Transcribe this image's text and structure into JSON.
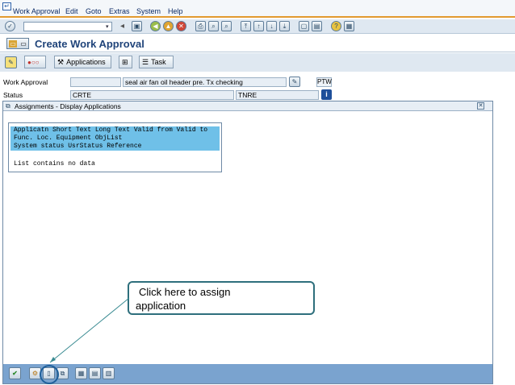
{
  "menu": {
    "items": [
      "Work Approval",
      "Edit",
      "Goto",
      "Extras",
      "System",
      "Help"
    ]
  },
  "screen": {
    "title": "Create Work Approval"
  },
  "app_toolbar": {
    "applications_label": "Applications",
    "task_label": "Task"
  },
  "form": {
    "work_approval_label": "Work Approval",
    "work_approval_value": "",
    "work_approval_desc": "seal air fan oil header pre. Tx checking",
    "ptw_label": "PTW",
    "status_label": "Status",
    "status_value": "CRTE",
    "status_user": "TNRE"
  },
  "dialog": {
    "title": "Assignments - Display Applications",
    "header_rows": [
      "Applicatn Short Text Long Text Valid from Valid to",
      "Func. Loc. Equipment ObjList",
      "System status UsrStatus Reference"
    ],
    "empty_message": "List contains no data"
  },
  "callout": {
    "text_line1": "Click here to assign",
    "text_line2": "application"
  },
  "colors": {
    "accent_blue": "#20447a",
    "highlight": "#6fc0e8",
    "toolbar_bg": "#dfe8f1",
    "bottom_bar": "#7aa3cf",
    "callout_border": "#2e6f7c"
  }
}
